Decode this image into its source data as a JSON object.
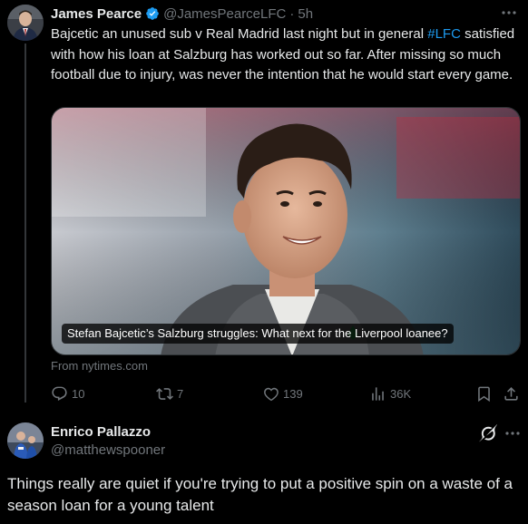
{
  "tweet1": {
    "name": "James Pearce",
    "handle": "@JamesPearceLFC",
    "separator": "·",
    "time": "5h",
    "text_before": "Bajcetic an unused sub v Real Madrid last night but in general ",
    "hashtag": "#LFC",
    "text_after": " satisfied with how his loan at Salzburg has worked out so far. After missing so much football due to injury, was never the intention that he would start every game.",
    "card": {
      "title": "Stefan Bajcetic’s Salzburg struggles: What next for the Liverpool loanee?",
      "source": "From nytimes.com"
    },
    "actions": {
      "replies": "10",
      "reposts": "7",
      "likes": "139",
      "views": "36K"
    },
    "colors": {
      "link": "#1d9bf0",
      "verified": "#1d9bf0",
      "muted": "#71767b"
    }
  },
  "tweet2": {
    "name": "Enrico Pallazzo",
    "handle": "@matthewspooner",
    "text": "Things really are quiet if you're trying to put a positive spin on a waste of a season loan for a young talent"
  }
}
